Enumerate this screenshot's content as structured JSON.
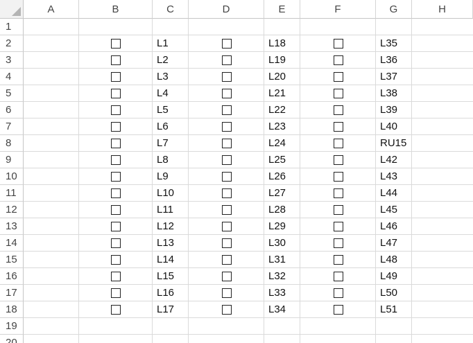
{
  "sheet": {
    "columns": [
      "A",
      "B",
      "C",
      "D",
      "E",
      "F",
      "G",
      "H"
    ],
    "rows": [
      "1",
      "2",
      "3",
      "4",
      "5",
      "6",
      "7",
      "8",
      "9",
      "10",
      "11",
      "12",
      "13",
      "14",
      "15",
      "16",
      "17",
      "18",
      "19",
      "20"
    ],
    "checkbox_columns": [
      "B",
      "D",
      "F"
    ],
    "label_columns": {
      "C": [
        "L1",
        "L2",
        "L3",
        "L4",
        "L5",
        "L6",
        "L7",
        "L8",
        "L9",
        "L10",
        "L11",
        "L12",
        "L13",
        "L14",
        "L15",
        "L16",
        "L17"
      ],
      "E": [
        "L18",
        "L19",
        "L20",
        "L21",
        "L22",
        "L23",
        "L24",
        "L25",
        "L26",
        "L27",
        "L28",
        "L29",
        "L30",
        "L31",
        "L32",
        "L33",
        "L34"
      ],
      "G": [
        "L35",
        "L36",
        "L37",
        "L38",
        "L39",
        "L40",
        "RU15",
        "L42",
        "L43",
        "L44",
        "L45",
        "L46",
        "L47",
        "L48",
        "L49",
        "L50",
        "L51"
      ]
    },
    "checkbox_rows": [
      "2",
      "3",
      "4",
      "5",
      "6",
      "7",
      "8",
      "9",
      "10",
      "11",
      "12",
      "13",
      "14",
      "15",
      "16",
      "17",
      "18"
    ]
  }
}
